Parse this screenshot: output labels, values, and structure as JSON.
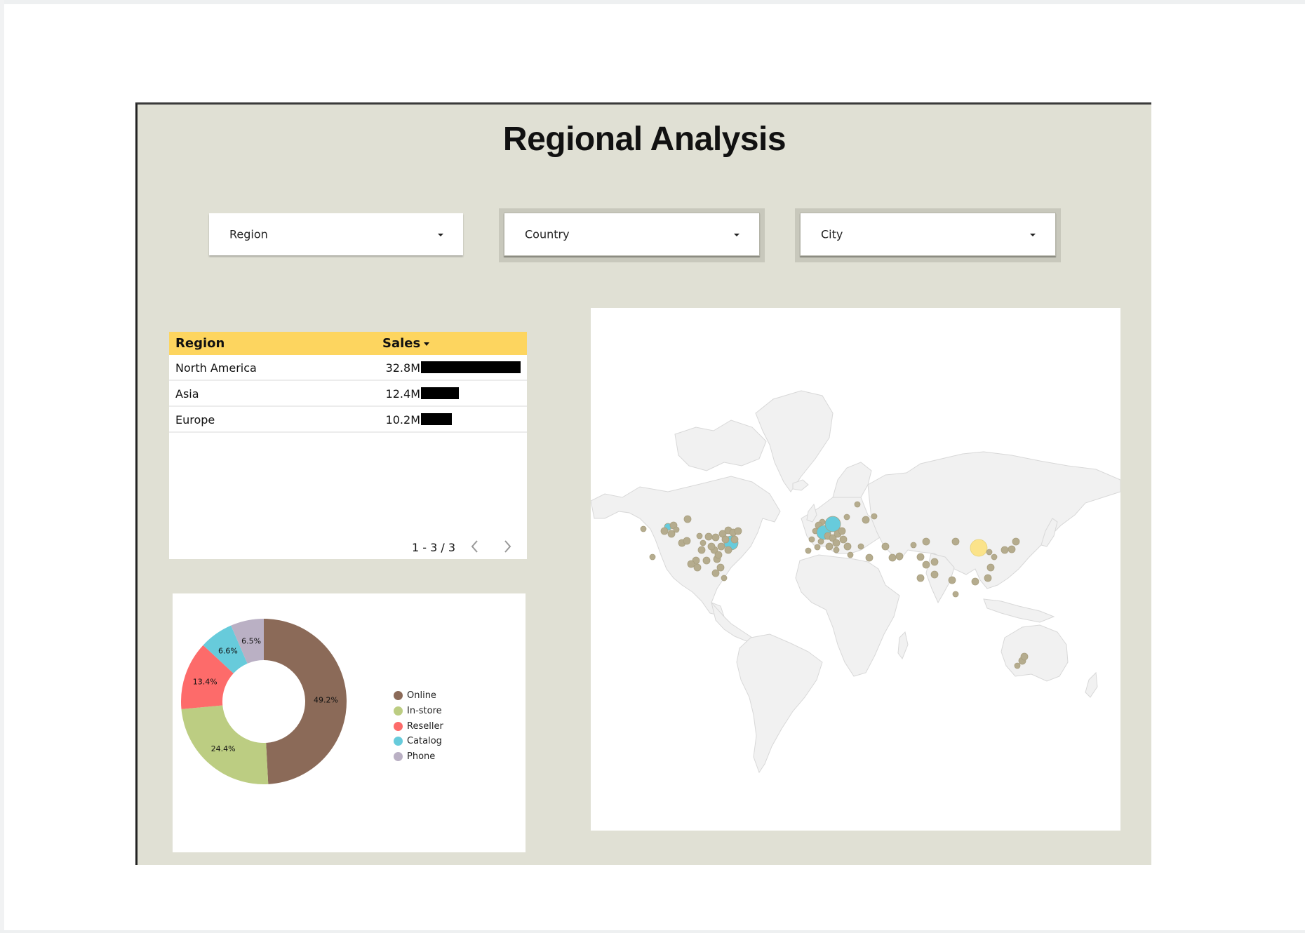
{
  "title": "Regional Analysis",
  "filters": [
    {
      "label": "Region"
    },
    {
      "label": "Country"
    },
    {
      "label": "City"
    }
  ],
  "table": {
    "columns": [
      "Region",
      "Sales"
    ],
    "sort_column": "Sales",
    "sort_direction": "descending",
    "rows": [
      {
        "region": "North America",
        "sales": "32.8M",
        "value": 32.8
      },
      {
        "region": "Asia",
        "sales": "12.4M",
        "value": 12.4
      },
      {
        "region": "Europe",
        "sales": "10.2M",
        "value": 10.2
      }
    ],
    "pagination": "1 - 3 / 3"
  },
  "chart_data": [
    {
      "type": "pie",
      "subtype": "donut",
      "title": "",
      "categories": [
        "Online",
        "In-store",
        "Reseller",
        "Catalog",
        "Phone"
      ],
      "values": [
        49.2,
        24.4,
        13.4,
        6.6,
        6.5
      ],
      "labels": [
        "49.2%",
        "24.4%",
        "13.4%",
        "6.6%",
        "6.5%"
      ],
      "colors": [
        "#8b6a58",
        "#bccd82",
        "#fd6b6a",
        "#67cbdb",
        "#bab0c4"
      ],
      "legend": "right"
    },
    {
      "type": "scatter",
      "subtype": "bubble-map",
      "title": "",
      "legend": "none",
      "colors": {
        "default": "#b5ac8e",
        "high": "#67cbdc",
        "highest": "#fbe38a"
      }
    }
  ]
}
